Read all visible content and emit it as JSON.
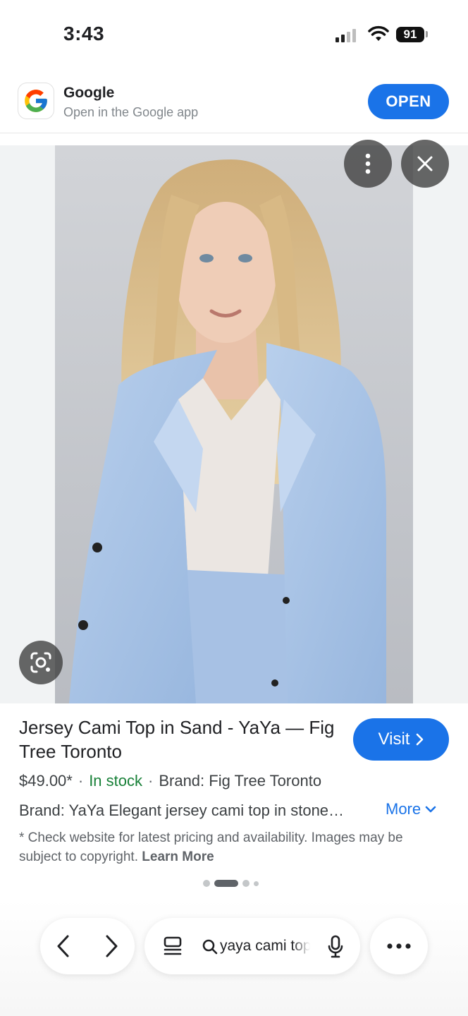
{
  "status_bar": {
    "time": "3:43",
    "battery": "91"
  },
  "app_banner": {
    "app_name": "Google",
    "subtitle": "Open in the Google app",
    "open_label": "OPEN"
  },
  "product": {
    "title": "Jersey Cami Top in Sand - YaYa — Fig Tree Toronto",
    "visit_label": "Visit",
    "price": "$49.00*",
    "stock": "In stock",
    "brand": "Brand: Fig Tree Toronto",
    "description": "Brand: YaYa Elegant jersey cami top in stone…",
    "more_label": "More",
    "disclaimer": "* Check website for latest pricing and availability. Images may be subject to copyright.",
    "learn_more": "Learn More"
  },
  "pager": {
    "count": 4,
    "active_index": 1
  },
  "toolbar": {
    "search_query": "yaya cami top"
  },
  "colors": {
    "accent": "#1a73e8",
    "stock_green": "#188038",
    "blazer_blue": "#a9c4e6",
    "background": "#ffffff"
  },
  "icons": [
    "google-logo",
    "more-vert-icon",
    "close-icon",
    "lens-icon",
    "chevron-right-icon",
    "chevron-down-icon",
    "back-icon",
    "forward-icon",
    "tabs-icon",
    "search-icon",
    "mic-icon",
    "more-horiz-icon"
  ]
}
